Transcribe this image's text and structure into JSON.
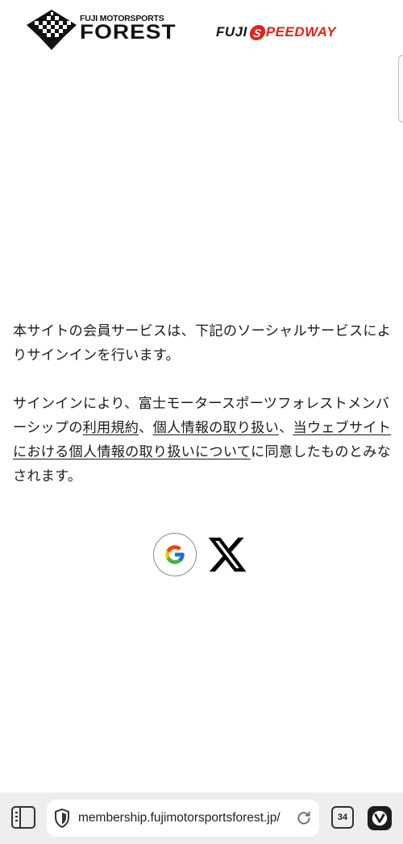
{
  "header": {
    "forest_logo": {
      "line1": "FUJI MOTORSPORTS",
      "line2": "FOREST"
    },
    "speedway_logo": {
      "part1": "FUJI",
      "s_letter": "S",
      "part2": "PEEDWAY",
      "accent_color": "#e2231a"
    }
  },
  "main": {
    "para1": "本サイトの会員サービスは、下記のソーシャルサービスによりサインインを行います。",
    "para2": {
      "prefix": "サインインにより、富士モータースポーツフォレストメンバーシップの",
      "link_terms": "利用規約",
      "sep1": "、",
      "link_privacy": "個人情報の取り扱い",
      "sep2": "、",
      "link_web_privacy": "当ウェブサイトにおける個人情報の取り扱いについて",
      "suffix": "に同意したものとみなされます。"
    },
    "social": [
      {
        "name": "google",
        "icon": "google-g-icon"
      },
      {
        "name": "x",
        "icon": "x-logo-icon"
      }
    ]
  },
  "browser": {
    "url": "membership.fujimotorsportsforest.jp/",
    "tab_count": "34",
    "icons": [
      "panel-toggle-icon",
      "shield-icon",
      "reload-icon",
      "vivaldi-menu-icon"
    ]
  }
}
